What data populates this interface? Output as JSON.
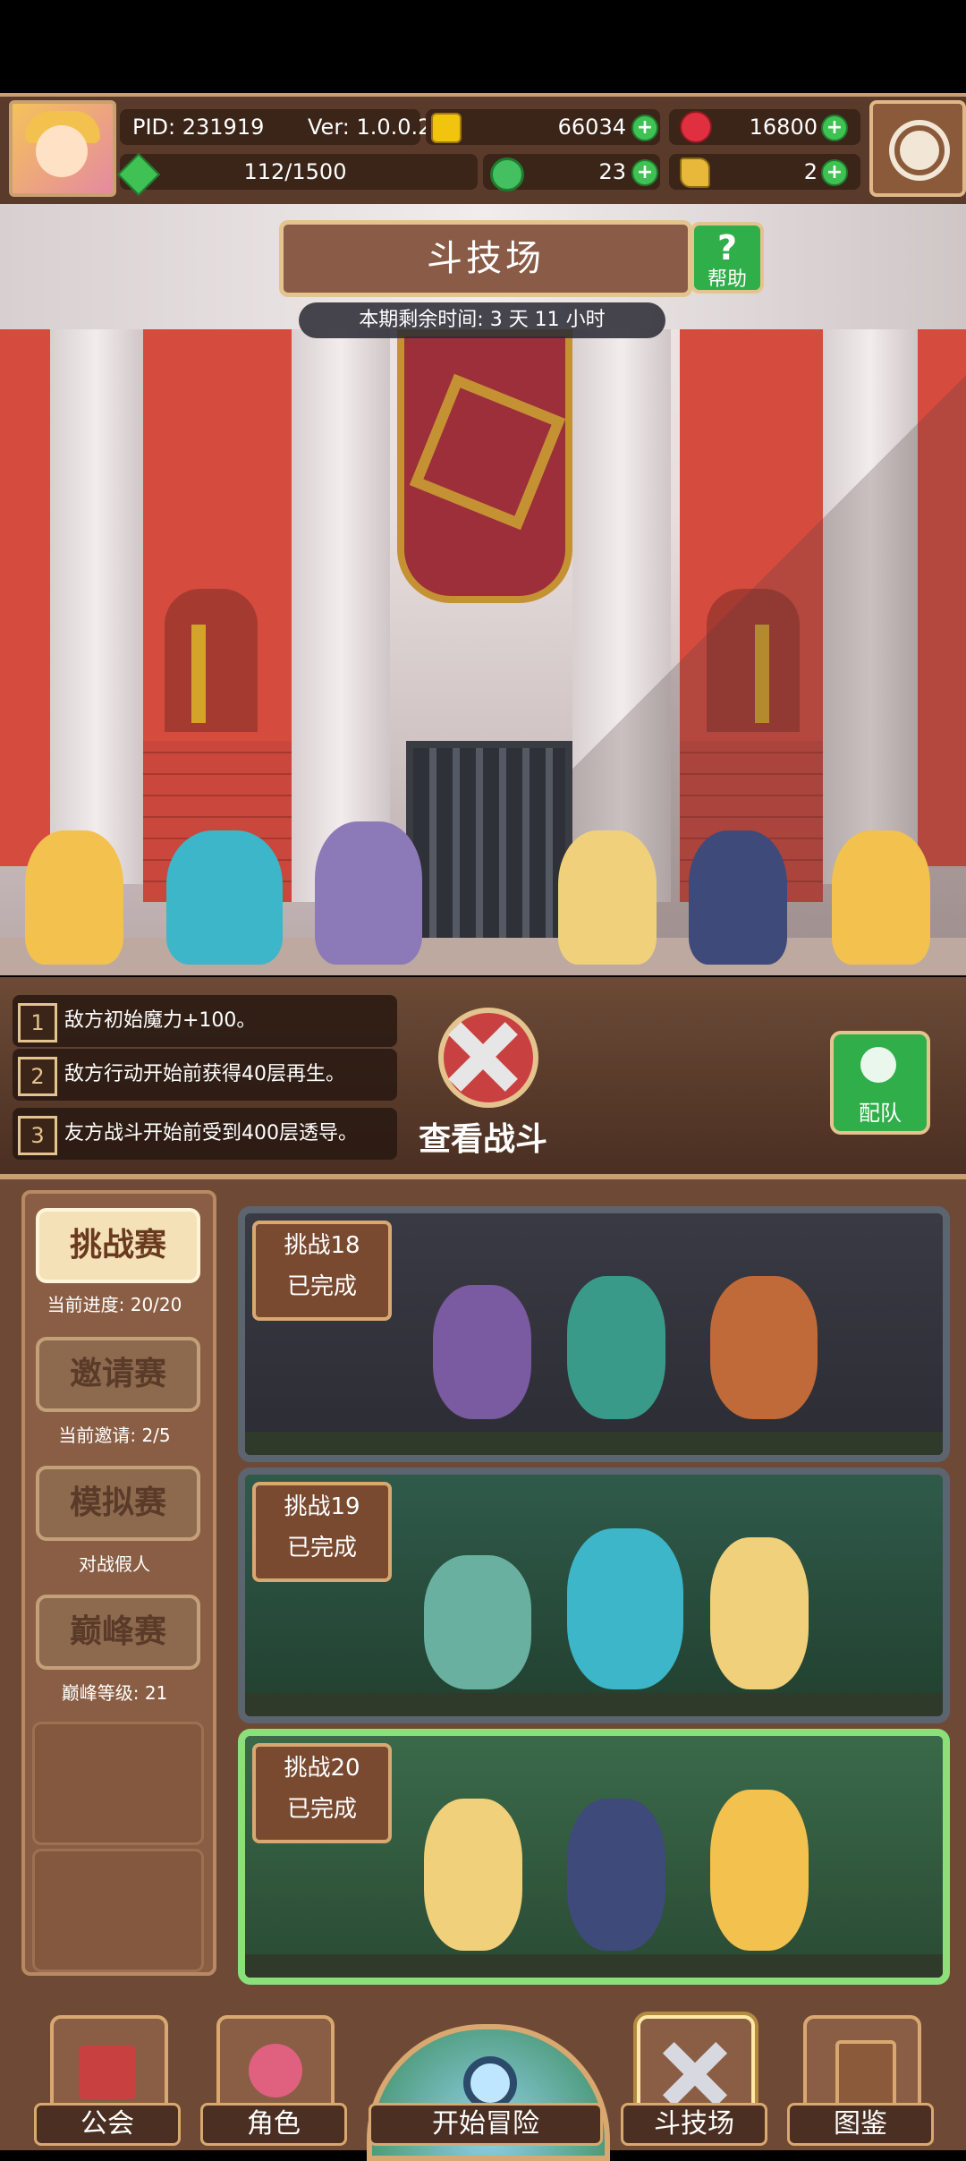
{
  "header": {
    "pid": "PID: 231919",
    "version": "Ver: 1.0.0.2",
    "gold": "66034",
    "gems": "16800",
    "stamina": "112/1500",
    "clover": "23",
    "boost": "2",
    "plus": "+"
  },
  "arena": {
    "title": "斗技场",
    "help_label": "帮助",
    "help_icon": "?",
    "timer": "本期剩余时间: 3 天 11 小时"
  },
  "rules": [
    {
      "num": "1",
      "text": "敌方初始魔力+100。"
    },
    {
      "num": "2",
      "text": "敌方行动开始前获得40层再生。"
    },
    {
      "num": "3",
      "text": "友方战斗开始前受到400层透导。"
    }
  ],
  "battle": {
    "view_label": "查看战斗",
    "team_label": "配队"
  },
  "modes": [
    {
      "label": "挑战赛",
      "sub": "当前进度: 20/20"
    },
    {
      "label": "邀请赛",
      "sub": "当前邀请: 2/5"
    },
    {
      "label": "模拟赛",
      "sub": "对战假人"
    },
    {
      "label": "巅峰赛",
      "sub": "巅峰等级: 21"
    }
  ],
  "challenges": [
    {
      "name": "挑战18",
      "status": "已完成"
    },
    {
      "name": "挑战19",
      "status": "已完成"
    },
    {
      "name": "挑战20",
      "status": "已完成"
    }
  ],
  "nav": {
    "guild": "公会",
    "character": "角色",
    "adventure": "开始冒险",
    "arena": "斗技场",
    "codex": "图鉴"
  }
}
